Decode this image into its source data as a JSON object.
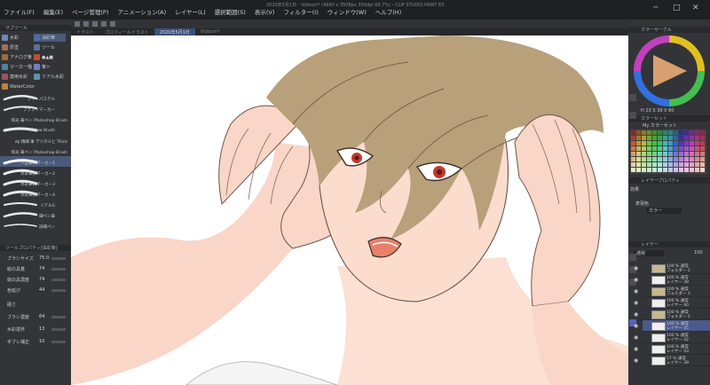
{
  "window": {
    "title": "2020年5月1日 - Vidoum* (4960 x 3508px 350dpi 66.7%) - CLIP STUDIO PAINT EX",
    "minimize": "─",
    "maximize": "□",
    "close": "✕"
  },
  "menu": [
    "ファイル(F)",
    "編集(E)",
    "ページ管理(P)",
    "アニメーション(A)",
    "レイヤー(L)",
    "選択範囲(S)",
    "表示(V)",
    "フィルター(I)",
    "ウィンドウ(W)",
    "ヘルプ(H)"
  ],
  "tabs": [
    "イラスト",
    "プロフィールイラスト",
    "2020年5月1日",
    "Vidoum*"
  ],
  "subtools": [
    {
      "label": "水彩",
      "color": "#6a8ab0"
    },
    {
      "label": "油彩筆",
      "color": "#4a6ea0",
      "selected": true
    },
    {
      "label": "厚塗",
      "color": "#a07050"
    },
    {
      "label": "ツール",
      "color": "#607090"
    },
    {
      "label": "アナログ筆",
      "color": "#9a6a3a"
    },
    {
      "label": "●▲■",
      "color": "#c05030"
    },
    {
      "label": "マーカー描",
      "color": "#5080a0"
    },
    {
      "label": "筆ト",
      "color": "#7080c0"
    },
    {
      "label": "専用水彩",
      "color": "#a05060"
    },
    {
      "label": "リアル水彩",
      "color": "#6090b0"
    },
    {
      "label": "WaterColor",
      "color": "#c08040"
    }
  ],
  "brushes": [
    {
      "label": "ライトパステル"
    },
    {
      "label": "ブラッドマーカー"
    },
    {
      "label": "和光 筆ペン Photoshop Brush"
    },
    {
      "label": "Mellow Brush"
    },
    {
      "label": "dp 精細 筆 デジタルと Thick"
    },
    {
      "label": "和光 筆ペン Photoshop Brush"
    },
    {
      "label": "ハ型筆状マーカー1",
      "selected": true
    },
    {
      "label": "水彩筆状マーカー2"
    },
    {
      "label": "水彩筆状マーカー3"
    },
    {
      "label": "水彩筆状マーカー4"
    },
    {
      "label": "リアルG"
    },
    {
      "label": "細ペン筆"
    },
    {
      "label": "詳細ペン"
    }
  ],
  "tool_property": {
    "header": "ツールプロパティ[油彩筆]",
    "rows": [
      {
        "label": "ブラシサイズ",
        "value": "75.0"
      },
      {
        "label": "絵の具量",
        "value": "74"
      },
      {
        "label": "絵の具濃度",
        "value": "74"
      },
      {
        "label": "色延び",
        "value": "44"
      },
      {
        "label": "硬さ",
        "value": ""
      },
      {
        "label": "ブラシ濃度",
        "value": "64"
      },
      {
        "label": "水彩境界",
        "value": "13"
      },
      {
        "label": "手ブレ補正",
        "value": "10"
      }
    ]
  },
  "color_panel": {
    "header": "カラーサークル",
    "hsv": [
      "H 23",
      "S 39",
      "V 80"
    ],
    "set_header": "カラーセット",
    "set_name": "My カラーセット"
  },
  "layer_property": {
    "header": "レイヤープロパティ",
    "effect_label": "効果",
    "color_label": "表現色",
    "color_value": "カラー"
  },
  "layers_panel": {
    "header": "レイヤー",
    "blend_mode": "通常",
    "opacity": "100",
    "layers": [
      {
        "pct": "100 % 通常",
        "name": "フォルダー 2",
        "folder": true
      },
      {
        "pct": "100 % 通常",
        "name": "レイヤー 38"
      },
      {
        "pct": "100 % 通常",
        "name": "フォルダー 3",
        "folder": true
      },
      {
        "pct": "100 % 通常",
        "name": "レイヤー 40"
      },
      {
        "pct": "100 % 通常",
        "name": "フォルダー 5",
        "folder": true
      },
      {
        "pct": "100 % 通常",
        "name": "レイヤー 45",
        "selected": true
      },
      {
        "pct": "100 % 通常",
        "name": "レイヤー 42"
      },
      {
        "pct": "100 % 通常",
        "name": "レイヤー 43"
      },
      {
        "pct": "57 % 通常",
        "name": "レイヤー 39"
      }
    ]
  },
  "colors": {
    "accent": "#4a5a8c",
    "skin": "#f9d6c8",
    "hair": "#b8a07a",
    "eye": "#c0392b",
    "line": "#3a2e28"
  }
}
